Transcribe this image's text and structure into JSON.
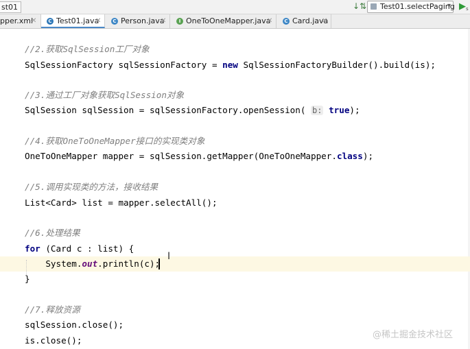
{
  "toolbar": {
    "breadcrumb": "st01",
    "sort_icon": "sort-icon",
    "run_config": "Test01.selectPaging",
    "run_icon": "run-icon"
  },
  "tabs": [
    {
      "label": "pper.xml",
      "icon": "xml-file-icon",
      "active": false
    },
    {
      "label": "Test01.java",
      "icon": "class-file-icon",
      "active": true
    },
    {
      "label": "Person.java",
      "icon": "class-file-icon",
      "active": false
    },
    {
      "label": "OneToOneMapper.java",
      "icon": "interface-file-icon",
      "active": false
    },
    {
      "label": "Card.java",
      "icon": "class-file-icon",
      "active": false
    }
  ],
  "code": {
    "c2": "//2.获取SqlSession工厂对象",
    "l2_a": "SqlSessionFactory sqlSessionFactory = ",
    "l2_kw": "new",
    "l2_b": " SqlSessionFactoryBuilder().build(is);",
    "c3": "//3.通过工厂对象获取SqlSession对象",
    "l3_a": "SqlSession sqlSession = sqlSessionFactory.openSession(",
    "l3_hint": "b:",
    "l3_kw": "true",
    "l3_b": ");",
    "c4": "//4.获取OneToOneMapper接口的实现类对象",
    "l4_a": "OneToOneMapper mapper = sqlSession.getMapper(OneToOneMapper.",
    "l4_kw": "class",
    "l4_b": ");",
    "c5": "//5.调用实现类的方法，接收结果",
    "l5": "List<Card> list = mapper.selectAll();",
    "c6": "//6.处理结果",
    "l6_kw": "for",
    "l6_b": " (Card c : list) {",
    "l7_a": "    System.",
    "l7_fld": "out",
    "l7_b": ".println(c);",
    "l8": "}",
    "c7": "//7.释放资源",
    "l9": "sqlSession.close();",
    "l10": "is.close();"
  },
  "watermark": "@稀土掘金技术社区"
}
